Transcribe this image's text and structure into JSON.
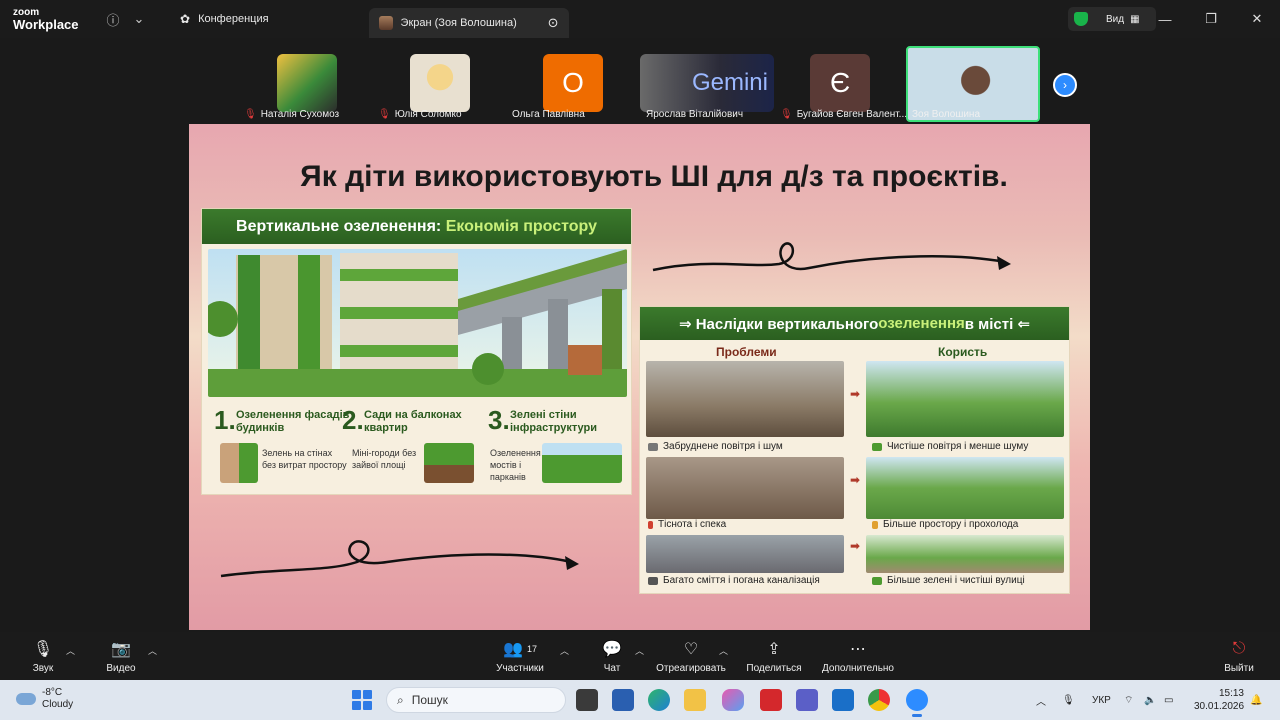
{
  "app": {
    "logo_line1": "zoom",
    "logo_line2": "Workplace",
    "tabs": [
      {
        "label": "Конференция"
      },
      {
        "label": "Экран (Зоя Волошина)"
      }
    ],
    "view_label": "Вид"
  },
  "participants": [
    {
      "name": "Наталія Сухомоз",
      "muted": true
    },
    {
      "name": "Юлія Соломко",
      "muted": true
    },
    {
      "name": "Ольга Павлівна",
      "muted": false,
      "initial": "О"
    },
    {
      "name": "Ярослав Віталійович",
      "muted": false,
      "thumb_text": "Gemini"
    },
    {
      "name": "Бугайов Євген Валент...",
      "muted": true,
      "initial": "Є"
    },
    {
      "name": "Зоя Волошина",
      "muted": false
    }
  ],
  "slide": {
    "title": "Як діти використовують ШІ для д/з та проєктів.",
    "left_panel": {
      "heading_a": "Вертикальне озеленення: ",
      "heading_b": "Економія простору",
      "features": [
        {
          "num": "1.",
          "title": "Озеленення фасадів будинків",
          "desc": "Зелень на стінах без витрат простору"
        },
        {
          "num": "2.",
          "title": "Сади на балконах квартир",
          "desc": "Міні-городи без зайвої площі"
        },
        {
          "num": "3.",
          "title": "Зелені стіни інфраструктури",
          "desc": "Озеленення мостів і парканів"
        }
      ]
    },
    "right_panel": {
      "heading_a": "⇒ Наслідки вертикального ",
      "heading_b": "озеленення",
      "heading_c": " в місті ⇐",
      "col_problems": "Проблеми",
      "col_benefits": "Користь",
      "rows": [
        {
          "problem": "Забруднене повітря і шум",
          "benefit": "Чистіше повітря і менше шуму"
        },
        {
          "problem": "Тіснота і спека",
          "benefit": "Більше простору і прохолода"
        },
        {
          "problem": "Багато сміття і погана каналізація",
          "benefit": "Більше зелені і чистіші вулиці"
        }
      ]
    }
  },
  "meeting_bar": {
    "audio": "Звук",
    "video": "Видео",
    "participants": "Участники",
    "participants_count": "17",
    "chat": "Чат",
    "react": "Отреагировать",
    "share": "Поделиться",
    "more": "Дополнительно",
    "leave": "Выйти"
  },
  "taskbar": {
    "temp": "-8°C",
    "weather": "Cloudy",
    "search_placeholder": "Пошук",
    "lang": "УКР",
    "time": "15:13",
    "date": "30.01.2026"
  },
  "colors": {
    "zoom_blue": "#2d8cff",
    "slide_green": "#2b5f20",
    "muted_red": "#e03a3a",
    "active_speaker": "#3ee07a"
  }
}
